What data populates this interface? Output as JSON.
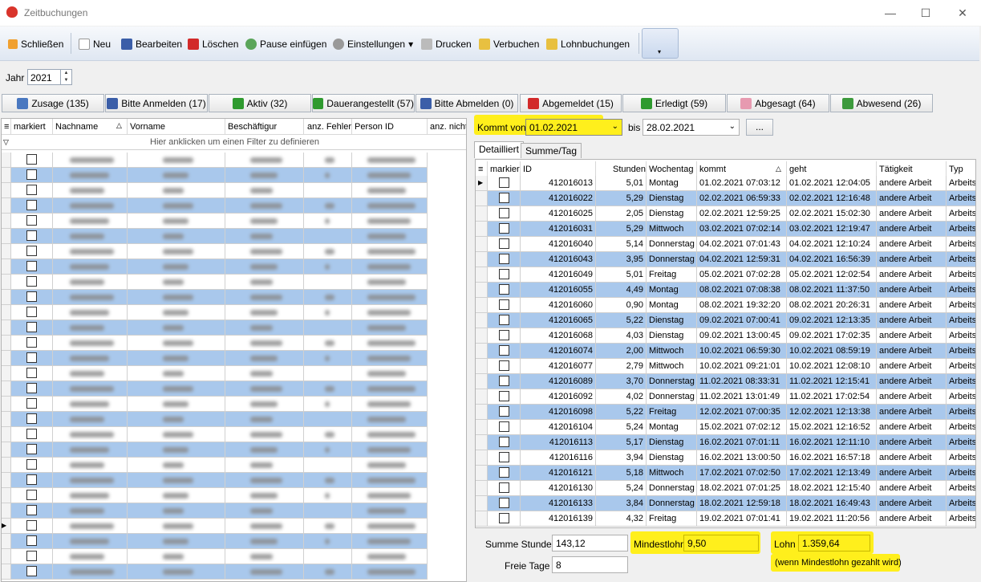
{
  "window": {
    "title": "Zeitbuchungen",
    "minimize": "—",
    "maximize": "☐",
    "close": "✕"
  },
  "toolbar": {
    "close": "Schließen",
    "new": "Neu",
    "edit": "Bearbeiten",
    "delete": "Löschen",
    "pause": "Pause einfügen",
    "settings": "Einstellungen",
    "settings_arrow": "▾",
    "print": "Drucken",
    "post": "Verbuchen",
    "payroll": "Lohnbuchungen",
    "more_arrow": "▾"
  },
  "year": {
    "label": "Jahr",
    "value": "2021"
  },
  "status_buttons": [
    {
      "label": "Zusage (135)",
      "icon": "car-icon",
      "color": "#4a78c0"
    },
    {
      "label": "Bitte Anmelden (17)",
      "icon": "pencil-icon",
      "color": "#3b5ea8"
    },
    {
      "label": "Aktiv (32)",
      "icon": "check-icon",
      "color": "#2f9a2f"
    },
    {
      "label": "Dauerangestellt (57)",
      "icon": "check-icon",
      "color": "#2f9a2f"
    },
    {
      "label": "Bitte Abmelden (0)",
      "icon": "pencil-icon",
      "color": "#3b5ea8"
    },
    {
      "label": "Abgemeldet (15)",
      "icon": "x-icon",
      "color": "#d22a2a"
    },
    {
      "label": "Erledigt (59)",
      "icon": "check-icon",
      "color": "#2f9a2f"
    },
    {
      "label": "Abgesagt (64)",
      "icon": "eraser-icon",
      "color": "#e79ab0"
    },
    {
      "label": "Abwesend (26)",
      "icon": "house-icon",
      "color": "#3c9a3c"
    }
  ],
  "left_grid": {
    "headers": [
      "markiert",
      "Nachname",
      "Vorname",
      "Beschäftigur",
      "anz. Fehler",
      "Person ID",
      "anz. nicht"
    ],
    "sort_indicator": "△",
    "filter_hint": "Hier anklicken um einen Filter zu definieren",
    "row_count": 28
  },
  "filter": {
    "from_label": "Kommt von",
    "from_value": "01.02.2021",
    "to_label": "bis",
    "to_value": "28.02.2021",
    "more_button": "..."
  },
  "tabs": [
    "Detailliert",
    "Summe/Tag"
  ],
  "detail_grid": {
    "headers": [
      "markier",
      "ID",
      "Stunden",
      "Wochentag",
      "kommt",
      "geht",
      "Tätigkeit",
      "Typ"
    ],
    "sort_indicator": "△",
    "rows": [
      [
        "412016013",
        "5,01",
        "Montag",
        "01.02.2021 07:03:12",
        "01.02.2021 12:04:05",
        "andere Arbeit",
        "Arbeits"
      ],
      [
        "412016022",
        "5,29",
        "Dienstag",
        "02.02.2021 06:59:33",
        "02.02.2021 12:16:48",
        "andere Arbeit",
        "Arbeits"
      ],
      [
        "412016025",
        "2,05",
        "Dienstag",
        "02.02.2021 12:59:25",
        "02.02.2021 15:02:30",
        "andere Arbeit",
        "Arbeits"
      ],
      [
        "412016031",
        "5,29",
        "Mittwoch",
        "03.02.2021 07:02:14",
        "03.02.2021 12:19:47",
        "andere Arbeit",
        "Arbeits"
      ],
      [
        "412016040",
        "5,14",
        "Donnerstag",
        "04.02.2021 07:01:43",
        "04.02.2021 12:10:24",
        "andere Arbeit",
        "Arbeits"
      ],
      [
        "412016043",
        "3,95",
        "Donnerstag",
        "04.02.2021 12:59:31",
        "04.02.2021 16:56:39",
        "andere Arbeit",
        "Arbeits"
      ],
      [
        "412016049",
        "5,01",
        "Freitag",
        "05.02.2021 07:02:28",
        "05.02.2021 12:02:54",
        "andere Arbeit",
        "Arbeits"
      ],
      [
        "412016055",
        "4,49",
        "Montag",
        "08.02.2021 07:08:38",
        "08.02.2021 11:37:50",
        "andere Arbeit",
        "Arbeits"
      ],
      [
        "412016060",
        "0,90",
        "Montag",
        "08.02.2021 19:32:20",
        "08.02.2021 20:26:31",
        "andere Arbeit",
        "Arbeits"
      ],
      [
        "412016065",
        "5,22",
        "Dienstag",
        "09.02.2021 07:00:41",
        "09.02.2021 12:13:35",
        "andere Arbeit",
        "Arbeits"
      ],
      [
        "412016068",
        "4,03",
        "Dienstag",
        "09.02.2021 13:00:45",
        "09.02.2021 17:02:35",
        "andere Arbeit",
        "Arbeits"
      ],
      [
        "412016074",
        "2,00",
        "Mittwoch",
        "10.02.2021 06:59:30",
        "10.02.2021 08:59:19",
        "andere Arbeit",
        "Arbeits"
      ],
      [
        "412016077",
        "2,79",
        "Mittwoch",
        "10.02.2021 09:21:01",
        "10.02.2021 12:08:10",
        "andere Arbeit",
        "Arbeits"
      ],
      [
        "412016089",
        "3,70",
        "Donnerstag",
        "11.02.2021 08:33:31",
        "11.02.2021 12:15:41",
        "andere Arbeit",
        "Arbeits"
      ],
      [
        "412016092",
        "4,02",
        "Donnerstag",
        "11.02.2021 13:01:49",
        "11.02.2021 17:02:54",
        "andere Arbeit",
        "Arbeits"
      ],
      [
        "412016098",
        "5,22",
        "Freitag",
        "12.02.2021 07:00:35",
        "12.02.2021 12:13:38",
        "andere Arbeit",
        "Arbeits"
      ],
      [
        "412016104",
        "5,24",
        "Montag",
        "15.02.2021 07:02:12",
        "15.02.2021 12:16:52",
        "andere Arbeit",
        "Arbeits"
      ],
      [
        "412016113",
        "5,17",
        "Dienstag",
        "16.02.2021 07:01:11",
        "16.02.2021 12:11:10",
        "andere Arbeit",
        "Arbeits"
      ],
      [
        "412016116",
        "3,94",
        "Dienstag",
        "16.02.2021 13:00:50",
        "16.02.2021 16:57:18",
        "andere Arbeit",
        "Arbeits"
      ],
      [
        "412016121",
        "5,18",
        "Mittwoch",
        "17.02.2021 07:02:50",
        "17.02.2021 12:13:49",
        "andere Arbeit",
        "Arbeits"
      ],
      [
        "412016130",
        "5,24",
        "Donnerstag",
        "18.02.2021 07:01:25",
        "18.02.2021 12:15:40",
        "andere Arbeit",
        "Arbeits"
      ],
      [
        "412016133",
        "3,84",
        "Donnerstag",
        "18.02.2021 12:59:18",
        "18.02.2021 16:49:43",
        "andere Arbeit",
        "Arbeits"
      ],
      [
        "412016139",
        "4,32",
        "Freitag",
        "19.02.2021 07:01:41",
        "19.02.2021 11:20:56",
        "andere Arbeit",
        "Arbeits"
      ]
    ]
  },
  "summary": {
    "hours_label": "Summe Stunden",
    "hours_value": "143,12",
    "free_label": "Freie Tage",
    "free_value": "8",
    "minwage_label": "Mindestlohn",
    "minwage_value": "9,50",
    "wage_label": "Lohn",
    "wage_value": "1.359,64",
    "wage_note": "(wenn Mindestlohn gezahlt wird)"
  },
  "colors": {
    "row_alt": "#a9c8ec",
    "highlight": "#ffef1c",
    "toolbar_border": "#c9d3e0"
  }
}
